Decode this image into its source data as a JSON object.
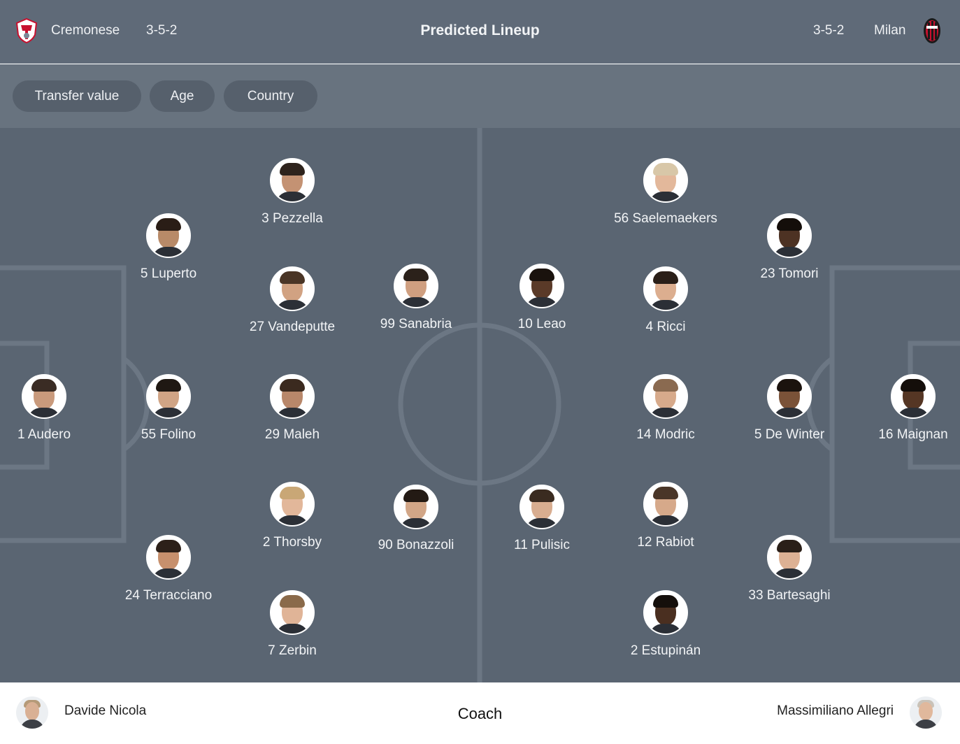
{
  "header": {
    "title": "Predicted Lineup",
    "home": {
      "name": "Cremonese",
      "formation": "3-5-2",
      "crest_icon": "cremonese-crest-icon"
    },
    "away": {
      "name": "Milan",
      "formation": "3-5-2",
      "crest_icon": "milan-crest-icon"
    }
  },
  "filters": [
    {
      "label": "Transfer value"
    },
    {
      "label": "Age"
    },
    {
      "label": "Country"
    }
  ],
  "home_players": [
    {
      "label": "1 Audero"
    },
    {
      "label": "5 Luperto"
    },
    {
      "label": "55 Folino"
    },
    {
      "label": "24 Terracciano"
    },
    {
      "label": "3 Pezzella"
    },
    {
      "label": "27 Vandeputte"
    },
    {
      "label": "29 Maleh"
    },
    {
      "label": "2 Thorsby"
    },
    {
      "label": "7 Zerbin"
    },
    {
      "label": "99 Sanabria"
    },
    {
      "label": "90 Bonazzoli"
    }
  ],
  "away_players": [
    {
      "label": "10 Leao"
    },
    {
      "label": "11 Pulisic"
    },
    {
      "label": "56 Saelemaekers"
    },
    {
      "label": "4 Ricci"
    },
    {
      "label": "14 Modric"
    },
    {
      "label": "12 Rabiot"
    },
    {
      "label": "2 Estupinán"
    },
    {
      "label": "23 Tomori"
    },
    {
      "label": "5 De Winter"
    },
    {
      "label": "33 Bartesaghi"
    },
    {
      "label": "16 Maignan"
    }
  ],
  "coaches": {
    "label": "Coach",
    "home": "Davide Nicola",
    "away": "Massimiliano Allegri"
  },
  "colors": {
    "header_bg": "#5f6a78",
    "filter_bg": "#68737f",
    "chip_bg": "#56606c",
    "pitch_bg": "#5a6572",
    "pitch_lines": "#6c7784"
  }
}
